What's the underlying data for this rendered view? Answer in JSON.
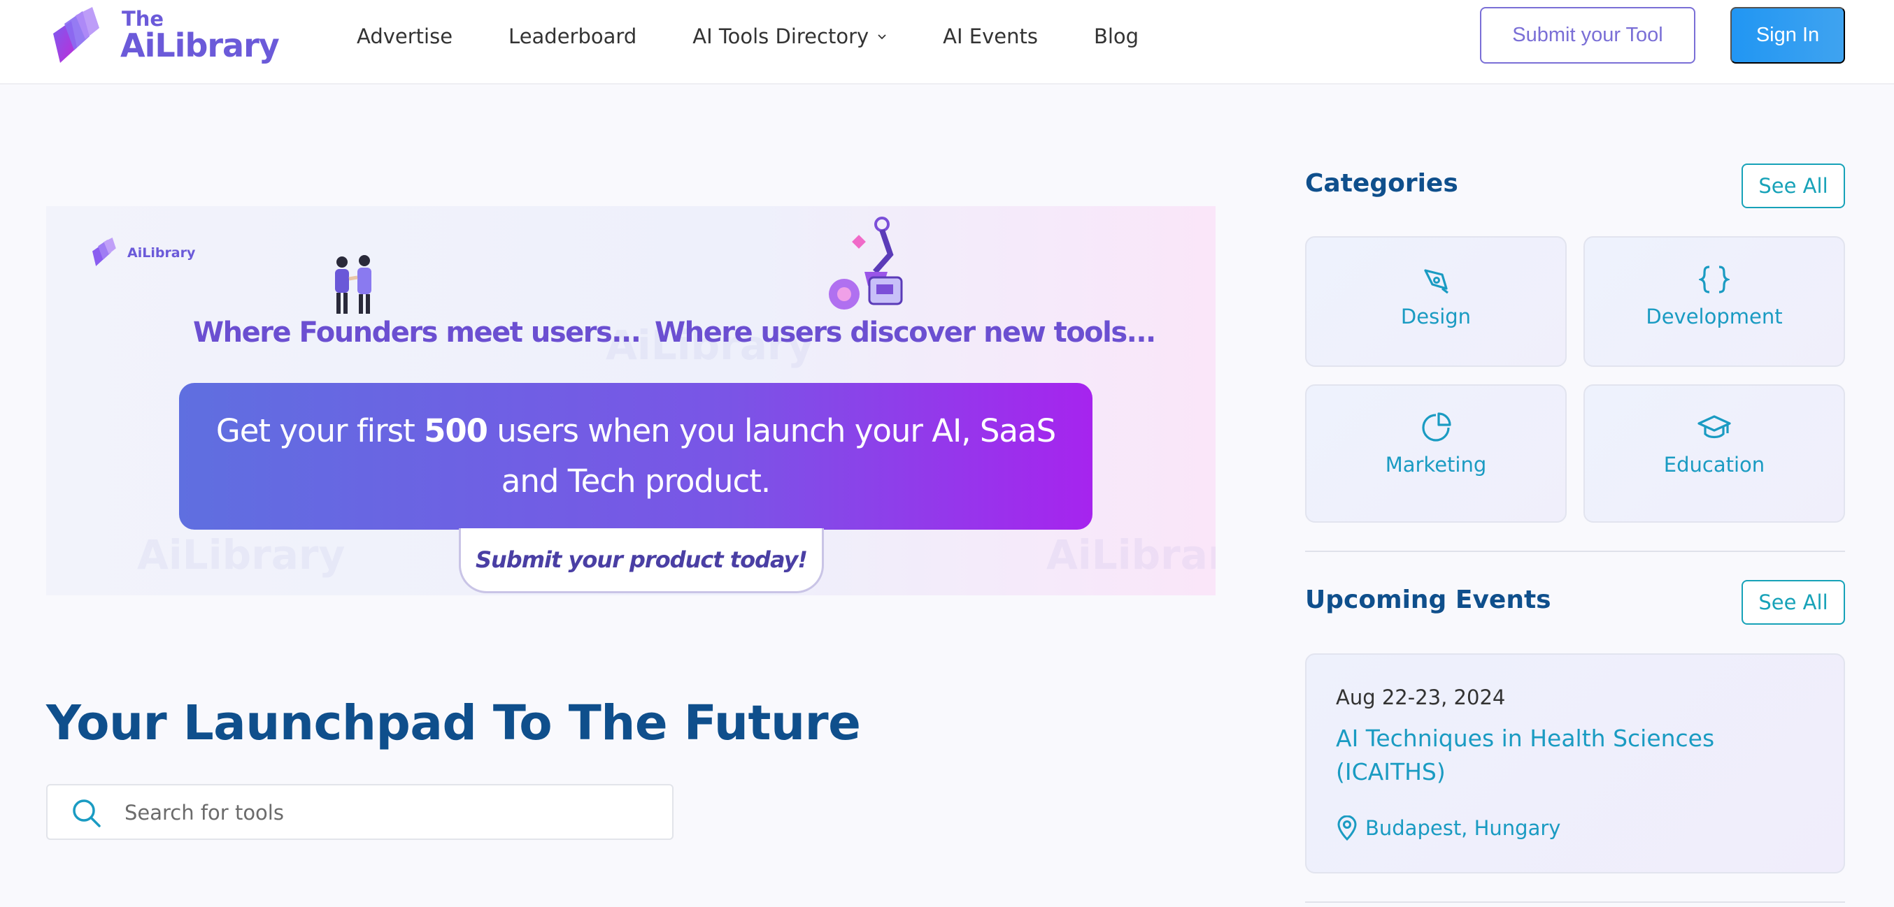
{
  "brand": {
    "the": "The",
    "name": "AiLibrary",
    "mini": "AiLibrary"
  },
  "nav": {
    "items": [
      {
        "label": "Advertise"
      },
      {
        "label": "Leaderboard"
      },
      {
        "label": "AI Tools Directory",
        "has_dropdown": true
      },
      {
        "label": "AI Events"
      },
      {
        "label": "Blog"
      }
    ],
    "submit_label": "Submit your Tool",
    "signin_label": "Sign In"
  },
  "banner": {
    "heading_left": "Where Founders meet users...",
    "heading_right": "Where users discover new tools...",
    "box_pre": "Get your first ",
    "box_number": "500",
    "box_post": " users when you launch your AI, SaaS",
    "box_line2": "and Tech product.",
    "cta": "Submit your product today!",
    "watermark": "AiLibrary"
  },
  "main": {
    "title": "Your Launchpad To The Future",
    "search_placeholder": "Search for tools"
  },
  "sidebar": {
    "categories_title": "Categories",
    "categories_see_all": "See All",
    "categories": [
      {
        "label": "Design",
        "icon": "pen-tool-icon"
      },
      {
        "label": "Development",
        "icon": "code-braces-icon"
      },
      {
        "label": "Marketing",
        "icon": "pie-chart-icon"
      },
      {
        "label": "Education",
        "icon": "graduation-cap-icon"
      }
    ],
    "events_title": "Upcoming Events",
    "events_see_all": "See All",
    "event": {
      "date": "Aug 22-23, 2024",
      "title": "AI Techniques in Health Sciences (ICAITHS)",
      "location": "Budapest, Hungary"
    }
  },
  "colors": {
    "brand_purple": "#6b5ad9",
    "heading_blue": "#0f4f8c",
    "accent_teal": "#1a9bc2",
    "signin_blue": "#2196f3"
  }
}
